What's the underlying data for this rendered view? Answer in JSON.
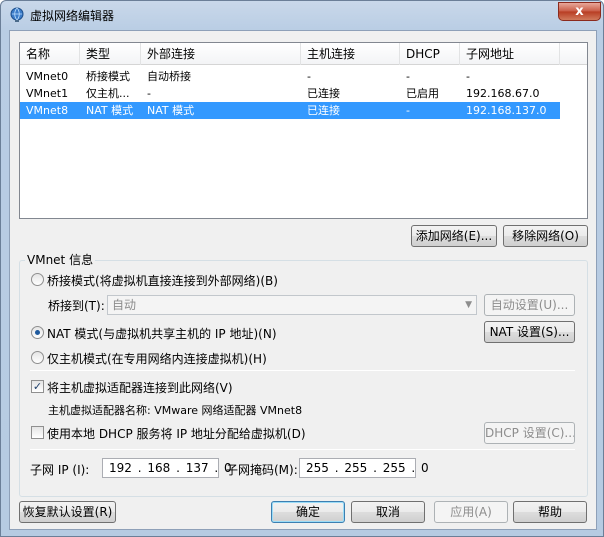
{
  "window": {
    "title": "虚拟网络编辑器",
    "close_glyph": "x"
  },
  "table": {
    "headers": [
      "名称",
      "类型",
      "外部连接",
      "主机连接",
      "DHCP",
      "子网地址"
    ],
    "rows": [
      {
        "name": "VMnet0",
        "type": "桥接模式",
        "external": "自动桥接",
        "host": "-",
        "dhcp": "-",
        "subnet": "-"
      },
      {
        "name": "VMnet1",
        "type": "仅主机...",
        "external": "-",
        "host": "已连接",
        "dhcp": "已启用",
        "subnet": "192.168.67.0"
      },
      {
        "name": "VMnet8",
        "type": "NAT 模式",
        "external": "NAT 模式",
        "host": "已连接",
        "dhcp": "-",
        "subnet": "192.168.137.0"
      }
    ],
    "selected_row": 2
  },
  "network_buttons": {
    "add": "添加网络(E)...",
    "remove": "移除网络(O)"
  },
  "vmnet_info": {
    "title": "VMnet 信息",
    "bridged_label": "桥接模式(将虚拟机直接连接到外部网络)(B)",
    "bridge_to_label": "桥接到(T):",
    "bridge_to_value": "自动",
    "auto_settings": "自动设置(U)...",
    "nat_label": "NAT 模式(与虚拟机共享主机的 IP 地址)(N)",
    "nat_settings": "NAT 设置(S)...",
    "hostonly_label": "仅主机模式(在专用网络内连接虚拟机)(H)",
    "selected_mode": "nat",
    "connect_adapter_label": "将主机虚拟适配器连接到此网络(V)",
    "connect_adapter_checked": true,
    "adapter_name_label": "主机虚拟适配器名称: VMware 网络适配器 VMnet8",
    "dhcp_label": "使用本地 DHCP 服务将 IP 地址分配给虚拟机(D)",
    "dhcp_checked": false,
    "dhcp_settings": "DHCP 设置(C)...",
    "subnet_ip_label": "子网 IP (I):",
    "subnet_ip_value": "192 . 168 . 137 .  0",
    "subnet_mask_label": "子网掩码(M):",
    "subnet_mask_value": "255 . 255 . 255 .  0"
  },
  "footer": {
    "restore_defaults": "恢复默认设置(R)",
    "ok": "确定",
    "cancel": "取消",
    "apply": "应用(A)",
    "help": "帮助"
  },
  "colors": {
    "selection": "#3399ff",
    "title_gradient": "#b9cde4",
    "close_button": "#c85a44"
  }
}
